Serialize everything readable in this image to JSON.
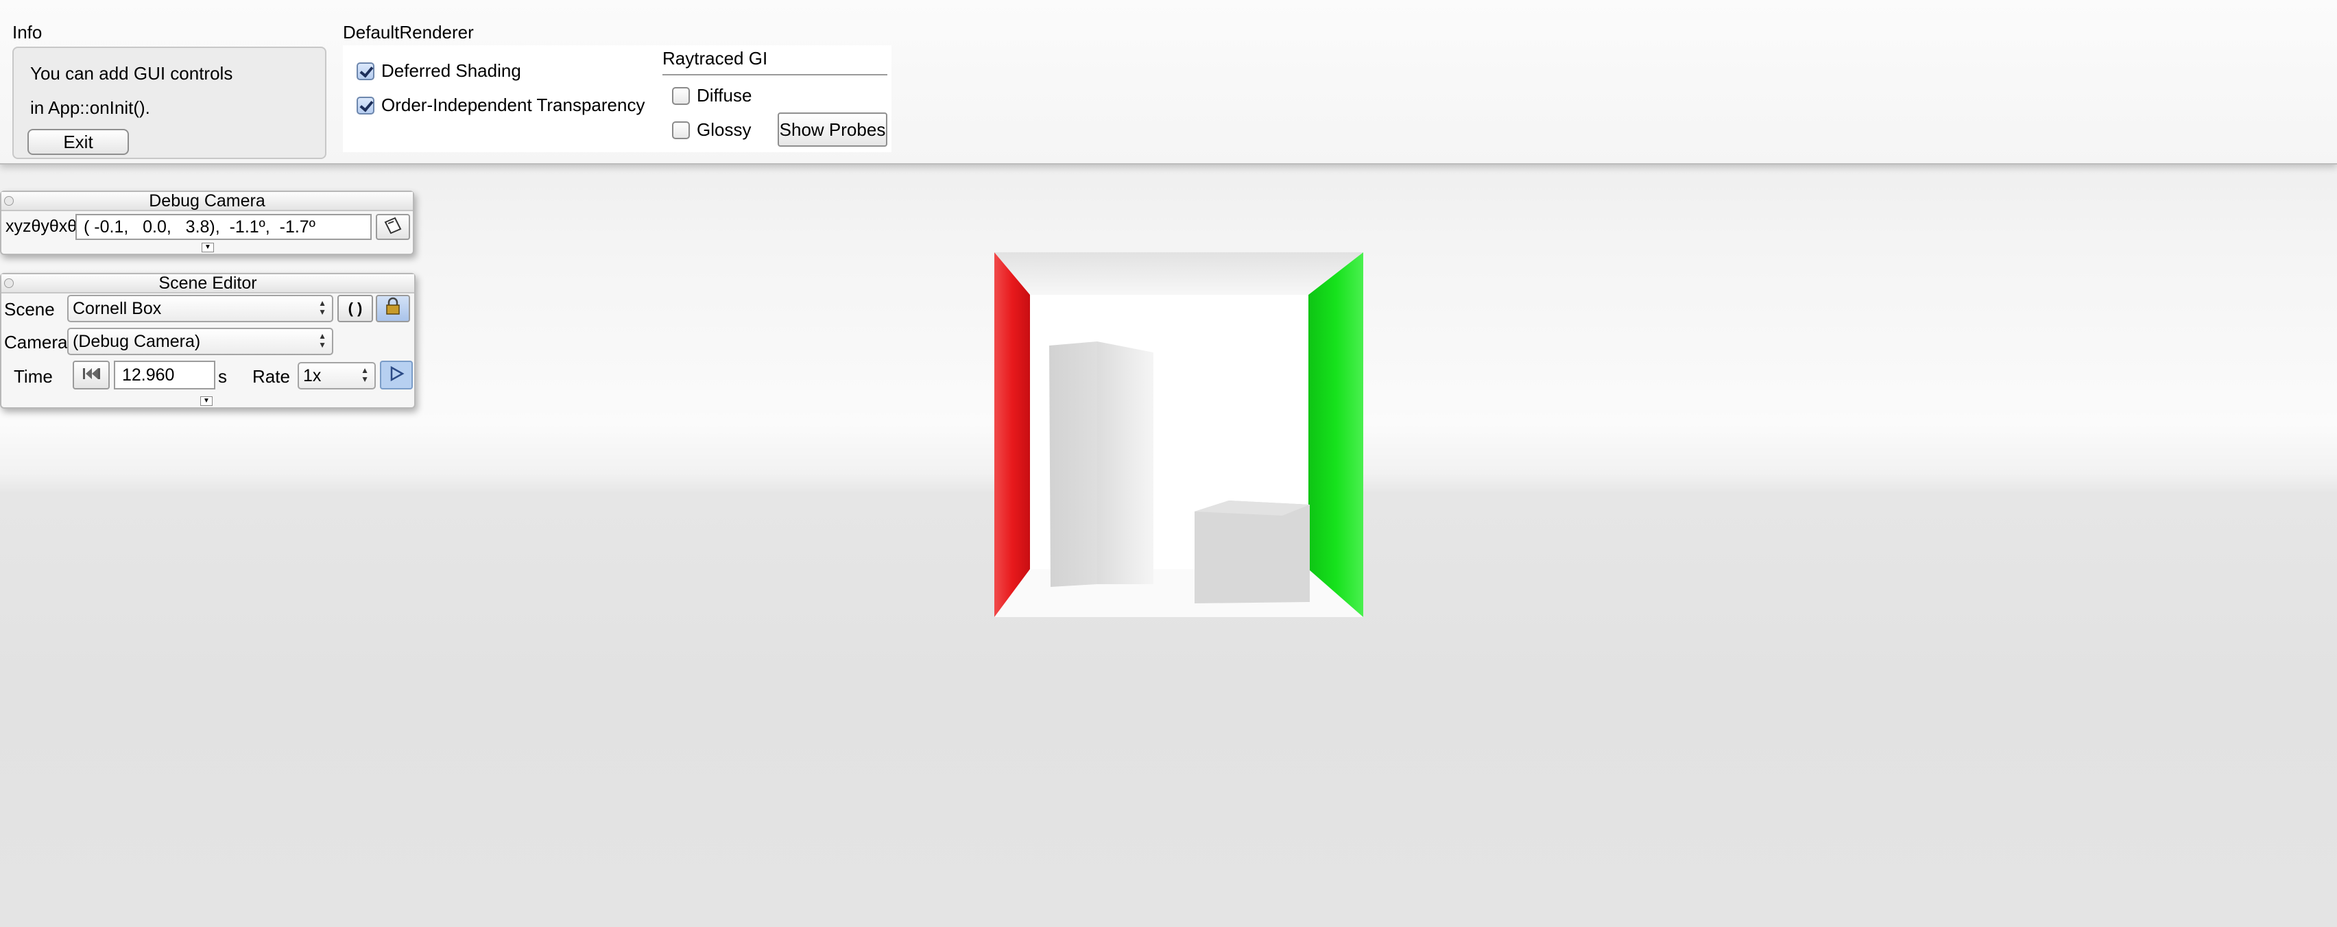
{
  "info_pane": {
    "title": "Info",
    "line1": "You can add GUI controls",
    "line2": "in App::onInit().",
    "exit_label": "Exit"
  },
  "renderer_pane": {
    "title": "DefaultRenderer",
    "deferred_label": "Deferred Shading",
    "deferred_checked": true,
    "oit_label": "Order-Independent Transparency",
    "oit_checked": true,
    "raytraced_title": "Raytraced GI",
    "diffuse_label": "Diffuse",
    "diffuse_checked": false,
    "glossy_label": "Glossy",
    "glossy_checked": false,
    "show_probes_label": "Show Probes"
  },
  "debug_camera": {
    "title": "Debug Camera",
    "coord_label": "xyzθyθxθz",
    "coord_value": "( -0.1,   0.0,   3.8),  -1.1º,  -1.7º"
  },
  "scene_editor": {
    "title": "Scene Editor",
    "scene_label": "Scene",
    "scene_value": "Cornell Box",
    "camera_label": "Camera",
    "camera_value": "(Debug Camera)",
    "time_label": "Time",
    "time_value": "12.960",
    "time_unit": "s",
    "rate_label": "Rate",
    "rate_value": "1x",
    "reload_glyph": "( )"
  },
  "colors": {
    "left_wall": "#e8191c",
    "right_wall": "#16e21c",
    "play_button": "#b7d0f1"
  }
}
